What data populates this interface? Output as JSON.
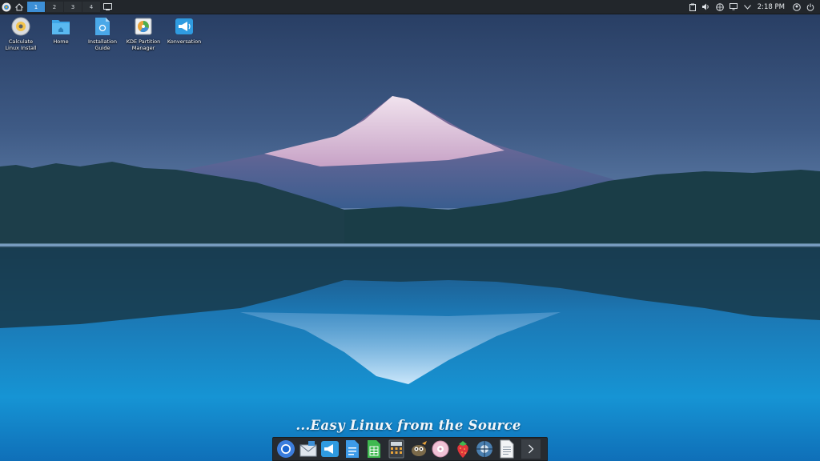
{
  "top_panel": {
    "launcher_icon": "calculate-logo-icon",
    "home_icon": "home-icon",
    "desktops": [
      "1",
      "2",
      "3",
      "4"
    ],
    "active_desktop": "1",
    "show_desktop_icon": "show-desktop-icon",
    "tray_icons": [
      "clipboard-icon",
      "volume-icon",
      "network-icon",
      "display-icon",
      "chevron-down-icon"
    ],
    "clock": "2:18 PM",
    "account_icon": "user-icon",
    "power_icon": "power-icon"
  },
  "desktop_icons": [
    {
      "label": "Calculate\nLinux Install",
      "icon": "disc-install-icon"
    },
    {
      "label": "Home",
      "icon": "folder-home-icon"
    },
    {
      "label": "Installation\nGuide",
      "icon": "document-guide-icon"
    },
    {
      "label": "KDE Partition\nManager",
      "icon": "partition-manager-icon"
    },
    {
      "label": "Konversation",
      "icon": "konversation-icon"
    }
  ],
  "wallpaper_slogan": "...Easy Linux from the Source",
  "dock_items": [
    "chromium-icon",
    "mail-icon",
    "konversation-icon",
    "document-icon",
    "spreadsheet-icon",
    "calculator-icon",
    "gimp-icon",
    "disc-burner-icon",
    "strawberry-icon",
    "network-tool-icon",
    "text-editor-icon",
    "chevron-right-icon"
  ],
  "colors": {
    "panel_bg": "#22262b",
    "active_desktop": "#3d8fd6",
    "dock_bg": "#272b30"
  }
}
